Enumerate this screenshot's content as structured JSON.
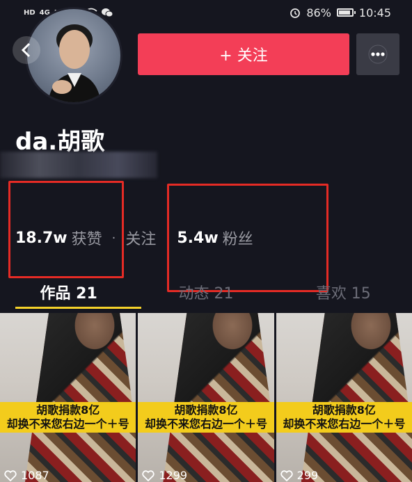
{
  "status_bar": {
    "left_icons": [
      "HD",
      "4G",
      "HD",
      "4G"
    ],
    "alarm_icon": "alarm-icon",
    "battery_percent": "86%",
    "time": "10:45"
  },
  "profile": {
    "follow_label": "+ 关注",
    "username": "da.胡歌"
  },
  "stats": [
    {
      "value": "18.7w",
      "label": "获赞"
    },
    {
      "value": "",
      "label": "关注"
    },
    {
      "value": "5.4w",
      "label": "粉丝"
    }
  ],
  "tabs": [
    {
      "label": "作品 21",
      "active": true
    },
    {
      "label": "动态 21",
      "active": false
    },
    {
      "label": "喜欢 15",
      "active": false
    }
  ],
  "videos": [
    {
      "caption_line1": "胡歌捐款8亿",
      "caption_line2": "却换不来您右边一个＋号",
      "likes": "1087"
    },
    {
      "caption_line1": "胡歌捐款8亿",
      "caption_line2": "却换不来您右边一个＋号",
      "likes": "1299"
    },
    {
      "caption_line1": "胡歌捐款8亿",
      "caption_line2": "却换不来您右边一个＋号",
      "likes": "299"
    }
  ],
  "colors": {
    "accent": "#f33e57",
    "highlight": "#e52b25",
    "tab_indicator": "#f5d22a",
    "caption_bg": "#f3cc1c"
  }
}
